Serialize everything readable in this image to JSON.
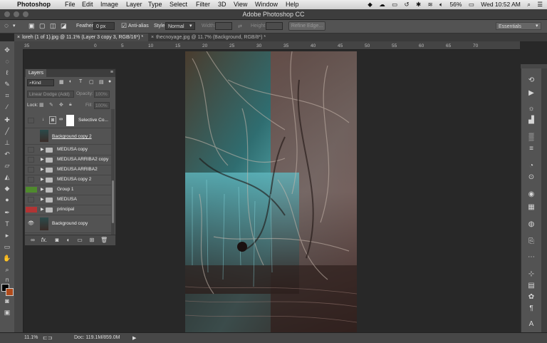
{
  "menubar": {
    "items": [
      "Photoshop",
      "File",
      "Edit",
      "Image",
      "Layer",
      "Type",
      "Select",
      "Filter",
      "3D",
      "View",
      "Window",
      "Help"
    ],
    "battery": "56%",
    "clock": "Wed 10:52 AM"
  },
  "window": {
    "title": "Adobe Photoshop CC"
  },
  "options": {
    "feather_label": "Feather:",
    "feather_value": "0 px",
    "antialias_label": "Anti-alias",
    "style_label": "Style:",
    "style_value": "Normal",
    "width_label": "Width:",
    "height_label": "Height:",
    "refine_edge_label": "Refine Edge...",
    "workspace_value": "Essentials"
  },
  "tabs": [
    {
      "label": "loreh (1 of 1).jpg @ 11.1% (Layer 3 copy 3, RGB/16*) *"
    },
    {
      "label": "thecnoyage.jpg @ 11.7% (Background, RGB/8*) *"
    }
  ],
  "ruler": {
    "ticks": [
      "35",
      "0",
      "5",
      "10",
      "15",
      "20",
      "25",
      "30",
      "35",
      "40",
      "45",
      "50",
      "55",
      "60",
      "65",
      "70"
    ]
  },
  "layers": {
    "panel_title": "Layers",
    "filter_kind": "Kind",
    "blend_mode": "Linear Dodge (Add)",
    "opacity_label": "Opacity:",
    "opacity_value": "100%",
    "lock_label": "Lock:",
    "fill_label": "Fill:",
    "fill_value": "100%",
    "items": [
      {
        "name": "Selective Co...",
        "kind": "adjustment",
        "eye_color": ""
      },
      {
        "name": "Background copy 2",
        "kind": "pixel",
        "eye_color": ""
      },
      {
        "name": "MEDUSA copy",
        "kind": "group",
        "eye_color": ""
      },
      {
        "name": "MEDUSA ARRIBA2 copy",
        "kind": "group",
        "eye_color": ""
      },
      {
        "name": "MEDUSA ARRIBA2",
        "kind": "group",
        "eye_color": ""
      },
      {
        "name": "MEDUSA copy 2",
        "kind": "group",
        "eye_color": ""
      },
      {
        "name": "Group 1",
        "kind": "group",
        "eye_color": "#4f8a2d"
      },
      {
        "name": "MEDUSA",
        "kind": "group",
        "eye_color": ""
      },
      {
        "name": "principal",
        "kind": "group",
        "eye_color": "#b23434"
      },
      {
        "name": "Background copy",
        "kind": "pixel",
        "eye_color": ""
      }
    ]
  },
  "status": {
    "zoom": "11.1%",
    "doc": "Doc: 119.1M/859.0M"
  },
  "colors": {
    "foreground": "#000000",
    "background": "#b04a1a"
  }
}
